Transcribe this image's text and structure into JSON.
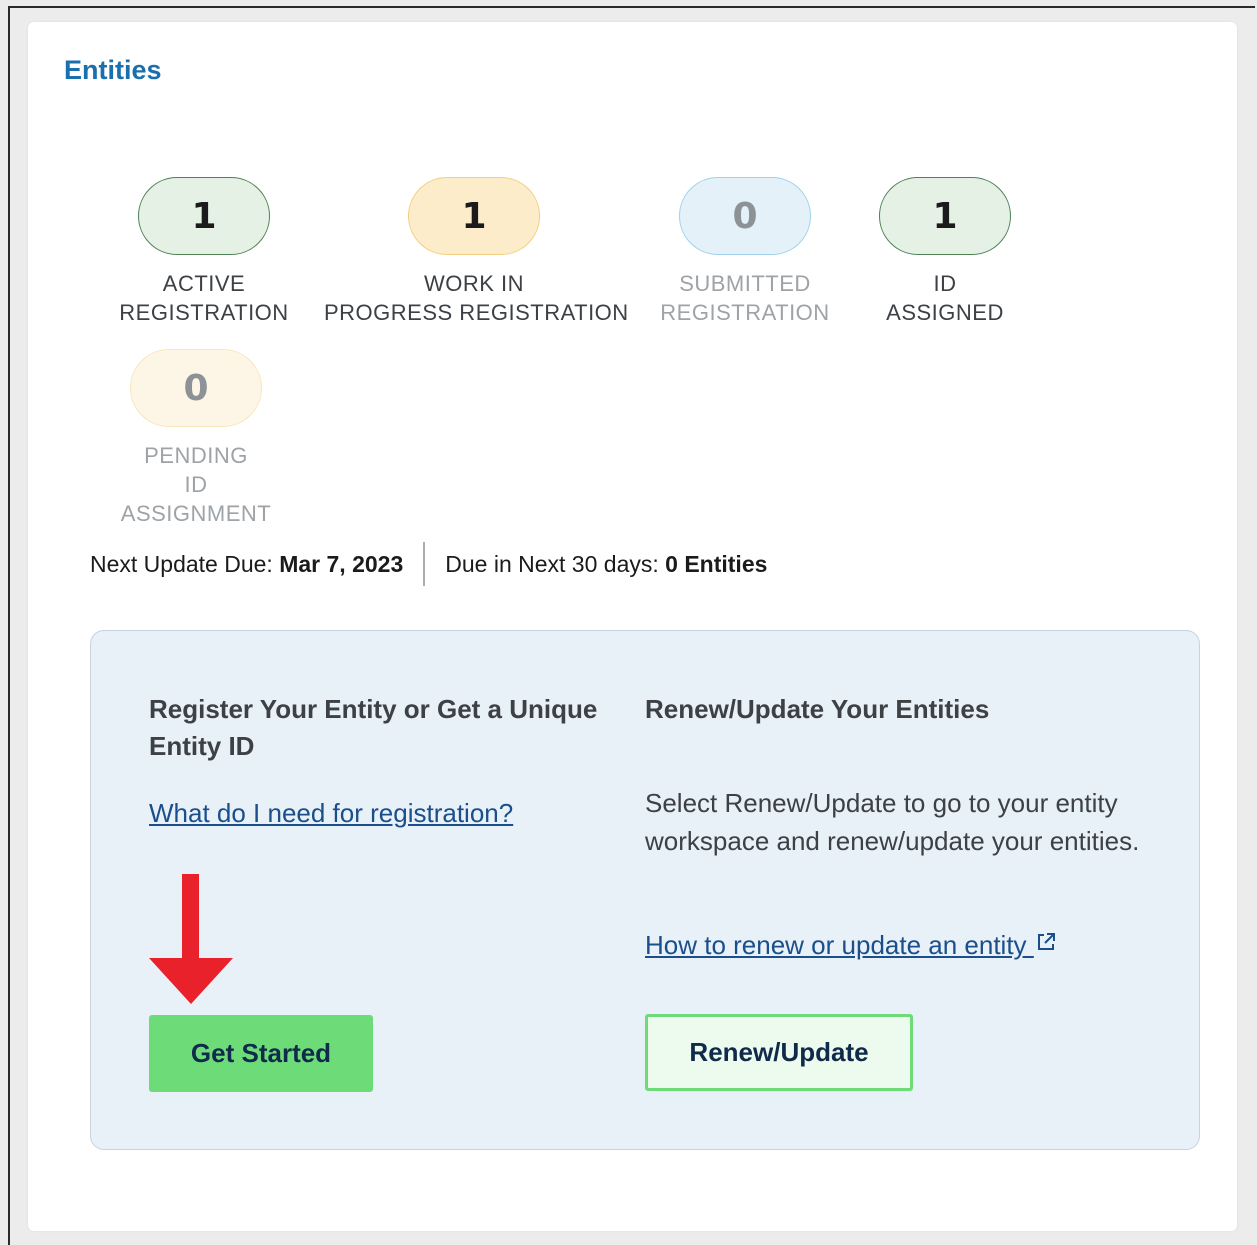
{
  "card": {
    "title": "Entities"
  },
  "stats": [
    {
      "count": "1",
      "label_line1": "ACTIVE",
      "label_line2": "REGISTRATION",
      "bg": "#e6f1e6",
      "border": "#4d8055"
    },
    {
      "count": "1",
      "label_line1": "WORK IN",
      "label_line2": "PROGRESS REGISTRATION",
      "bg": "#fdecc9",
      "border": "#f2cf83"
    },
    {
      "count": "0",
      "label_line1": "SUBMITTED",
      "label_line2": "REGISTRATION",
      "bg": "#e4f1f8",
      "border": "#9fd2ea"
    },
    {
      "count": "1",
      "label_line1": "ID",
      "label_line2": "ASSIGNED",
      "bg": "#e6f1e6",
      "border": "#4d8055"
    },
    {
      "count": "0",
      "label_line1": "PENDING",
      "label_line2": "ID",
      "label_line3": "ASSIGNMENT",
      "bg": "#fdf6e6",
      "border": "#f8e6bd"
    }
  ],
  "summary": {
    "next_update_label": "Next Update Due: ",
    "next_update_date": "Mar 7, 2023",
    "due_label": "Due in Next 30 days: ",
    "due_value": "0 Entities"
  },
  "register": {
    "title": "Register Your Entity or Get a Unique Entity ID",
    "link": "What do I need for registration?",
    "button": "Get Started"
  },
  "renew": {
    "title": "Renew/Update Your Entities",
    "description": "Select Renew/Update to go to your entity workspace and renew/update your entities.",
    "link": "How to renew or update an entity",
    "link_icon": "external-link-icon",
    "button": "Renew/Update"
  },
  "colors": {
    "title_blue": "#1a6fae",
    "panel_bg": "#e8f0f8",
    "button_green": "#6ddc78",
    "arrow_red": "#e8212b"
  }
}
